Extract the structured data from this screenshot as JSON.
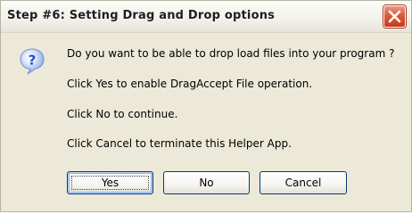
{
  "window": {
    "title": "Step #6: Setting Drag and Drop options",
    "close_icon": "close-x-icon"
  },
  "dialog": {
    "icon": "question-icon",
    "messages": [
      "Do you want to be able to drop load files into your program ?",
      "Click Yes to enable DragAccept File operation.",
      "Click No to continue.",
      "Click Cancel to terminate this Helper App."
    ]
  },
  "buttons": {
    "yes": "Yes",
    "no": "No",
    "cancel": "Cancel"
  },
  "colors": {
    "dialog_bg": "#ece9d8",
    "close_button": "#d9593b",
    "button_border": "#003c74",
    "icon_blue": "#3a6fd1"
  }
}
